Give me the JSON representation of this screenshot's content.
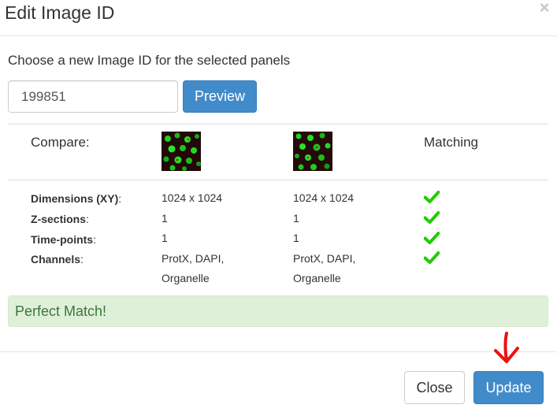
{
  "dialog": {
    "title": "Edit Image ID",
    "close_symbol": "×",
    "prompt": "Choose a new Image ID for the selected panels",
    "image_id_value": "199851",
    "preview_label": "Preview"
  },
  "compare": {
    "compare_label": "Compare:",
    "matching_label": "Matching",
    "rows": [
      {
        "label": "Dimensions (XY)",
        "suffix": ":",
        "current": "1024 x 1024",
        "new": "1024 x 1024",
        "match": true
      },
      {
        "label": "Z-sections",
        "suffix": ":",
        "current": "1",
        "new": "1",
        "match": true
      },
      {
        "label": "Time-points",
        "suffix": ":",
        "current": "1",
        "new": "1",
        "match": true
      },
      {
        "label": "Channels",
        "suffix": ":",
        "current_line1": "ProtX, DAPI,",
        "current_line2": "Organelle",
        "new_line1": "ProtX, DAPI,",
        "new_line2": "Organelle",
        "match": true
      }
    ]
  },
  "status": {
    "message": "Perfect Match!"
  },
  "footer": {
    "close_label": "Close",
    "update_label": "Update"
  },
  "colors": {
    "primary": "#428bca",
    "success_bg": "#dff0d8",
    "success_text": "#3c763d",
    "check": "#22cc00",
    "annotation_arrow": "#ee1111"
  },
  "icons": {
    "close": "close-icon",
    "match": "checkmark-icon",
    "annotation": "arrow-down-icon"
  }
}
